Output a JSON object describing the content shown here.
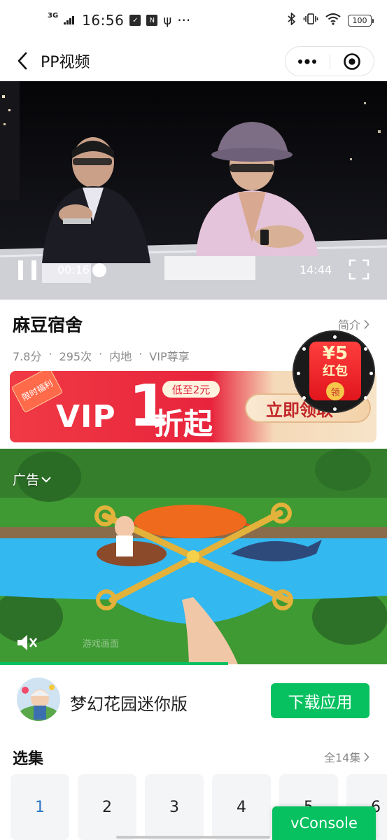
{
  "status_bar": {
    "network": "3G",
    "time": "16:56",
    "more": "···",
    "battery": "100"
  },
  "nav": {
    "title": "PP视频"
  },
  "video": {
    "current_time": "00:16",
    "duration": "14:44"
  },
  "info": {
    "title": "麻豆宿舍",
    "intro_label": "简介",
    "meta": {
      "score": "7.8分",
      "plays": "295次",
      "region": "内地",
      "vip": "VIP尊享"
    },
    "meta_separator": "·"
  },
  "vip_banner": {
    "corner_tag": "限时福利",
    "vip_text": "VIP",
    "number": "1",
    "tag": "低至2元",
    "suffix": "折起",
    "cta": "立即领取"
  },
  "red_packet": {
    "amount": "¥5",
    "label": "红包",
    "action": "领"
  },
  "ad": {
    "label": "广告",
    "watermark": "游戏画面"
  },
  "app": {
    "name": "梦幻花园迷你版",
    "download_label": "下载应用"
  },
  "episodes": {
    "heading": "选集",
    "all_label": "全14集",
    "items": [
      "1",
      "2",
      "3",
      "4",
      "5",
      "6"
    ],
    "active_index": 0
  },
  "vconsole": {
    "label": "vConsole"
  },
  "colors": {
    "accent_green": "#07c160",
    "active_episode": "#2b74c6",
    "vip_red": "#e8243c"
  }
}
